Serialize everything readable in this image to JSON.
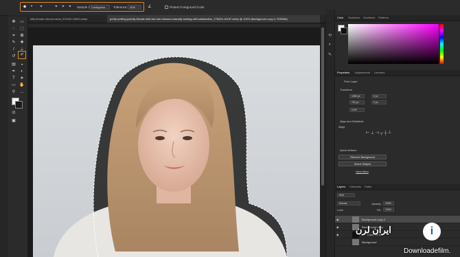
{
  "options_bar": {
    "sample_size": "Sample Size:",
    "contiguous_label": "Contiguous",
    "tolerance_label": "Tolerance:",
    "tolerance_value": "40%",
    "protect_label": "Protect Foreground Color",
    "accent": "#e88a1a"
  },
  "tabs": [
    {
      "label": "stlik-female-retouch-ideal_976420-16940.webp"
    },
    {
      "label": "pretty-smiling-joyfully-female-with-fair-hair-dressed-casually-looking-with-satisfaction_176420-15187.webp @ 100% (Background copy 2, RGB/8#)"
    }
  ],
  "right_panel": {
    "color_tabs": [
      "Color",
      "Swatches",
      "Gradients",
      "Patterns"
    ],
    "prop_tabs": [
      "Properties",
      "Adjustments",
      "Libraries"
    ],
    "pixel_layer": "Pixel Layer",
    "transform_title": "Transform",
    "w": "1080 px",
    "h": "754 px",
    "x": "0 px",
    "y": "0 px",
    "angle": "0.00°",
    "align_title": "Align and Distribute",
    "align_label": "Align:",
    "quick_title": "Quick Actions",
    "remove_bg": "Remove Background",
    "select_subject": "Select Subject",
    "view_more": "View More",
    "layer_tabs": [
      "Layers",
      "Channels",
      "Paths"
    ],
    "kind": "Kind",
    "blend": "Normal",
    "opacity_label": "Opacity:",
    "opacity": "100%",
    "lock_label": "Lock:",
    "fill_label": "Fill:",
    "fill": "100%",
    "layers": [
      {
        "name": "Background copy 2"
      },
      {
        "name": "Background copy"
      },
      {
        "name": "Color Fill 1"
      },
      {
        "name": "Background"
      }
    ]
  },
  "watermark": {
    "brand": "ایران لرن",
    "url": "Downloadefilm."
  }
}
